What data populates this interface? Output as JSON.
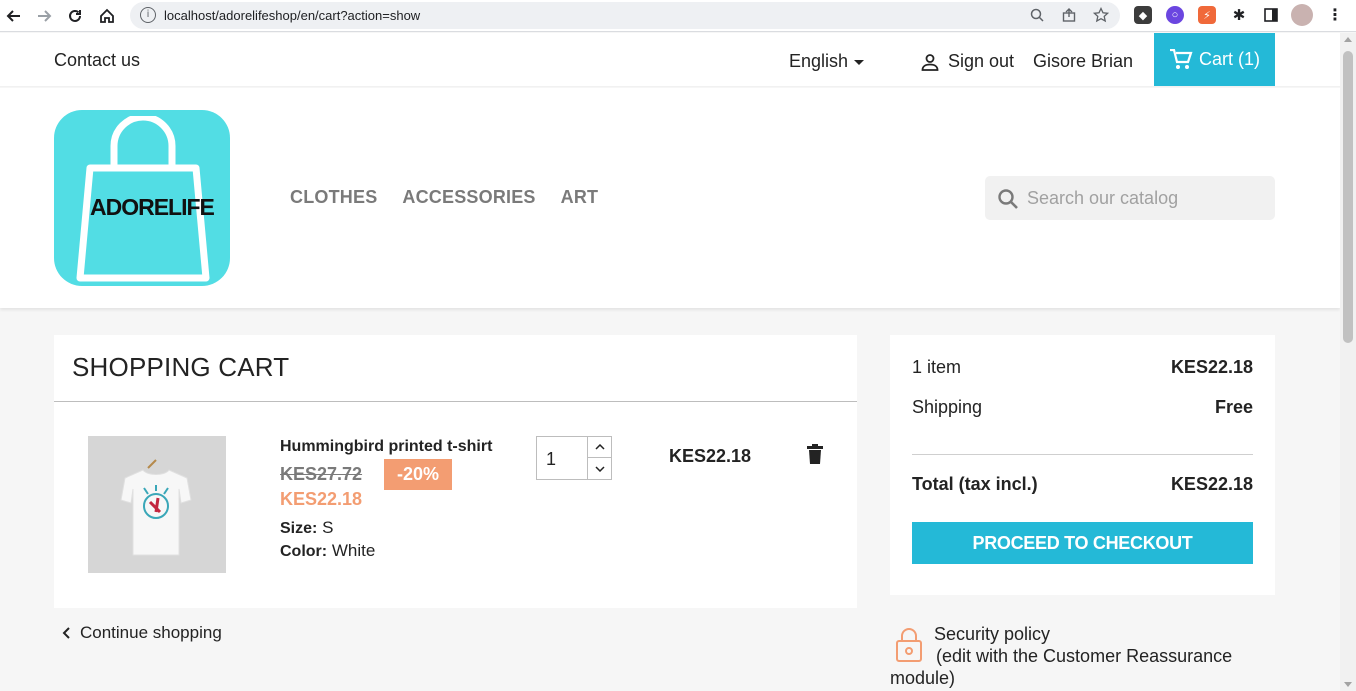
{
  "browser": {
    "url": "localhost/adorelifeshop/en/cart?action=show",
    "back_icon": "arrow-left-icon",
    "forward_icon": "arrow-right-icon",
    "reload_icon": "reload-icon",
    "home_icon": "home-icon"
  },
  "topnav": {
    "contact": "Contact us",
    "language": "English",
    "signout": "Sign out",
    "username": "Gisore Brian",
    "cart": "Cart (1)"
  },
  "header": {
    "logo_text": "ADORELIFE",
    "menu": [
      "CLOTHES",
      "ACCESSORIES",
      "ART"
    ],
    "search_placeholder": "Search our catalog"
  },
  "cart": {
    "title": "SHOPPING CART",
    "item": {
      "name": "Hummingbird printed t-shirt",
      "old_price": "KES27.72",
      "discount": "-20%",
      "price": "KES22.18",
      "size_label": "Size:",
      "size": "S",
      "color_label": "Color:",
      "color": "White",
      "quantity": "1",
      "line_total": "KES22.18"
    },
    "continue": "Continue shopping"
  },
  "summary": {
    "items_label": "1 item",
    "items_value": "KES22.18",
    "shipping_label": "Shipping",
    "shipping_value": "Free",
    "total_label": "Total (tax incl.)",
    "total_value": "KES22.18",
    "checkout": "PROCEED TO CHECKOUT"
  },
  "reassurance": {
    "line1": "Security policy",
    "line2": "(edit with the Customer Reassurance",
    "line3": "module)"
  },
  "colors": {
    "accent": "#24b9d7",
    "discount": "#f39d72",
    "logo_bg": "#52dde4"
  }
}
